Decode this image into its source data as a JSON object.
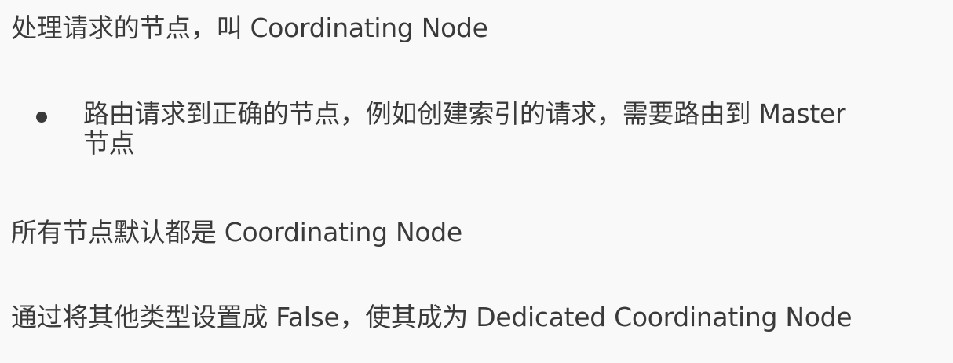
{
  "paragraphs": {
    "coordinating_intro": "处理请求的节点，叫 Coordinating Node",
    "default_role": "所有节点默认都是 Coordinating Node",
    "dedicated_setup": "通过将其他类型设置成 False，使其成为 Dedicated Coordinating Node"
  },
  "bullets": [
    {
      "line1": "路由请求到正确的节点，例如创建索引的请求，需要路由到 Master",
      "line2": "节点"
    }
  ]
}
